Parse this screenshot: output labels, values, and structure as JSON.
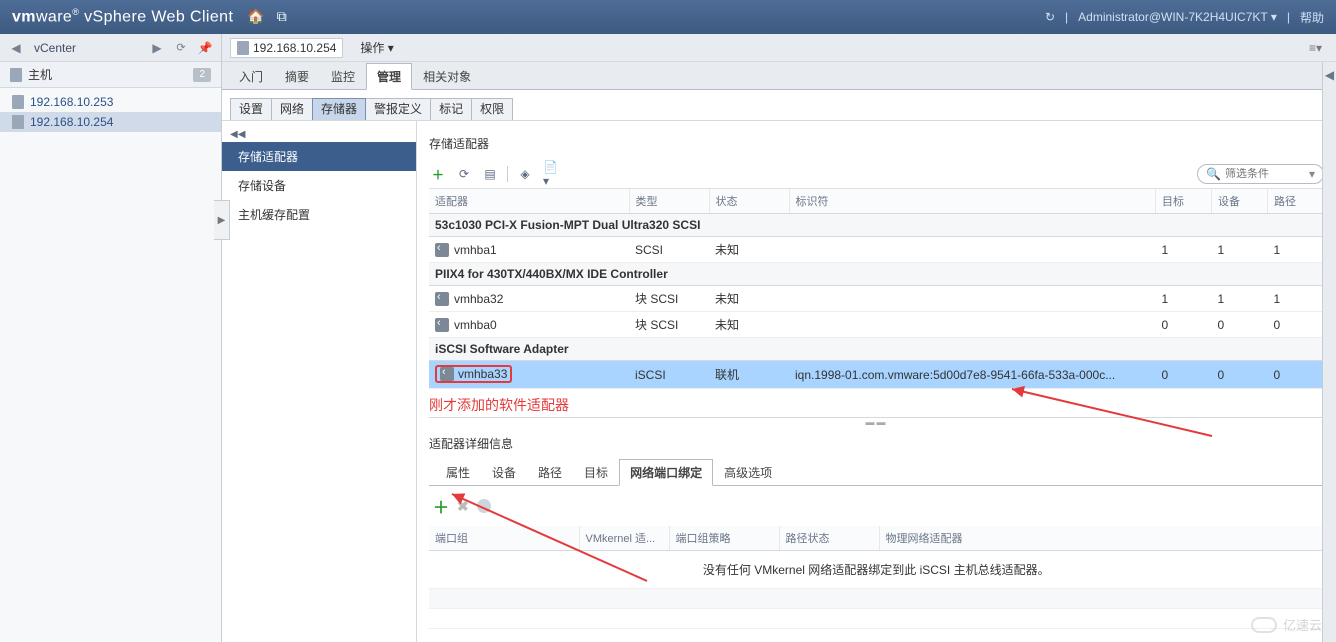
{
  "header": {
    "brand_html": "vmware® vSphere Web Client",
    "user": "Administrator@WIN-7K2H4UIC7KT",
    "help": "帮助"
  },
  "leftNav": {
    "context": "vCenter",
    "section": "主机",
    "badge": "2",
    "hosts": [
      "192.168.10.253",
      "192.168.10.254"
    ],
    "selectedIndex": 1
  },
  "crumb": {
    "host": "192.168.10.254",
    "actions": "操作 ▾"
  },
  "mainTabs": {
    "items": [
      "入门",
      "摘要",
      "监控",
      "管理",
      "相关对象"
    ],
    "active": 3
  },
  "subTabs": {
    "items": [
      "设置",
      "网络",
      "存储器",
      "警报定义",
      "标记",
      "权限"
    ],
    "active": 2
  },
  "mgmtNav": {
    "items": [
      "存储适配器",
      "存储设备",
      "主机缓存配置"
    ],
    "active": 0
  },
  "adapters": {
    "title": "存储适配器",
    "filterPlaceholder": "筛选条件",
    "columns": [
      "适配器",
      "类型",
      "状态",
      "标识符",
      "目标",
      "设备",
      "路径"
    ],
    "rows": [
      {
        "kind": "group",
        "label": "53c1030 PCI-X Fusion-MPT Dual Ultra320 SCSI"
      },
      {
        "kind": "item",
        "name": "vmhba1",
        "type": "SCSI",
        "status": "未知",
        "id": "",
        "target": "1",
        "dev": "1",
        "path": "1"
      },
      {
        "kind": "group",
        "label": "PIIX4 for 430TX/440BX/MX IDE Controller"
      },
      {
        "kind": "item",
        "name": "vmhba32",
        "type": "块 SCSI",
        "status": "未知",
        "id": "",
        "target": "1",
        "dev": "1",
        "path": "1"
      },
      {
        "kind": "item",
        "name": "vmhba0",
        "type": "块 SCSI",
        "status": "未知",
        "id": "",
        "target": "0",
        "dev": "0",
        "path": "0"
      },
      {
        "kind": "group",
        "label": "iSCSI Software Adapter"
      },
      {
        "kind": "item",
        "selected": true,
        "highlightName": true,
        "name": "vmhba33",
        "type": "iSCSI",
        "status": "联机",
        "id": "iqn.1998-01.com.vmware:5d00d7e8-9541-66fa-533a-000c...",
        "target": "0",
        "dev": "0",
        "path": "0"
      }
    ]
  },
  "annotation": "刚才添加的软件适配器",
  "details": {
    "title": "适配器详细信息",
    "tabs": [
      "属性",
      "设备",
      "路径",
      "目标",
      "网络端口绑定",
      "高级选项"
    ],
    "activeTab": 4,
    "portColumns": [
      "端口组",
      "VMkernel 适...",
      "端口组策略",
      "路径状态",
      "物理网络适配器"
    ],
    "emptyMsg": "没有任何 VMkernel 网络适配器绑定到此 iSCSI 主机总线适配器。"
  },
  "watermark": "亿速云"
}
